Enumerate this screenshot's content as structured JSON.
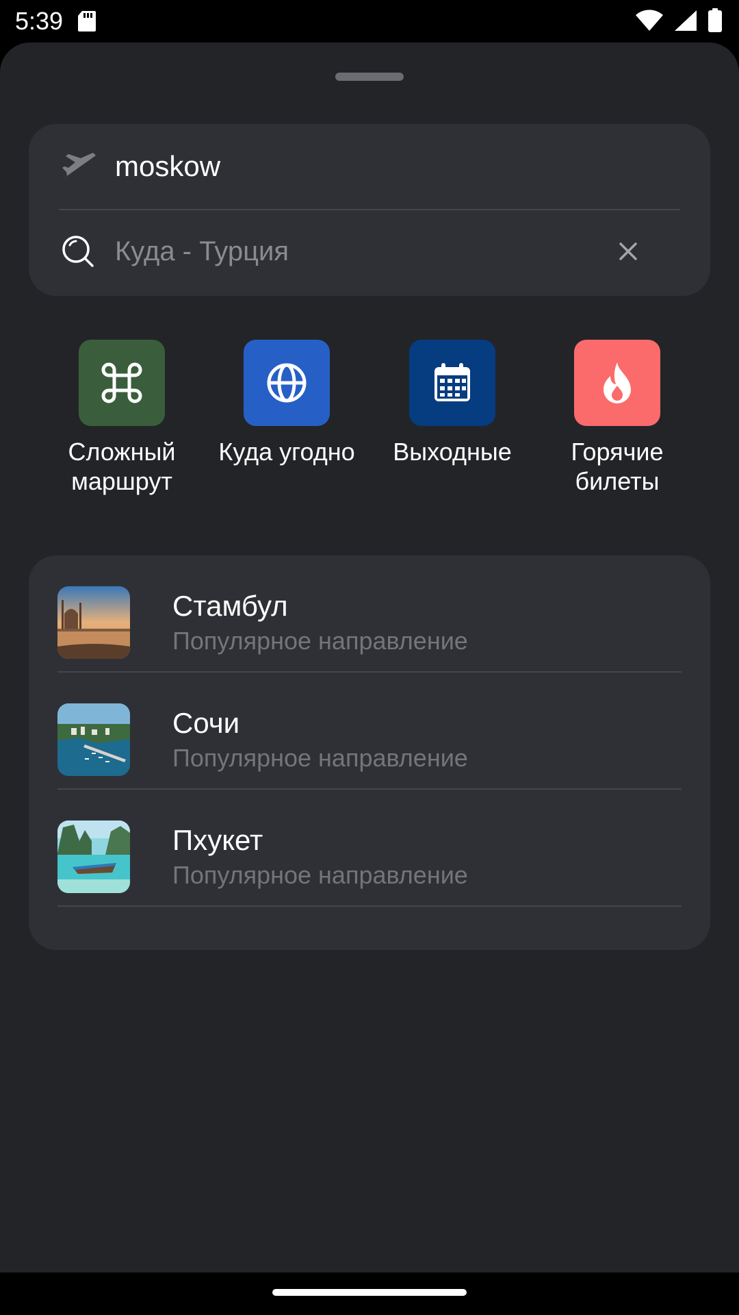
{
  "status_bar": {
    "time": "5:39"
  },
  "search": {
    "from_value": "moskow",
    "to_placeholder": "Куда - Турция"
  },
  "quick_actions": [
    {
      "label": "Сложный\nмаршрут",
      "icon": "command-icon",
      "color": "#3a5e3c"
    },
    {
      "label": "Куда угодно",
      "icon": "globe-icon",
      "color": "#2660c6"
    },
    {
      "label": "Выходные",
      "icon": "calendar-icon",
      "color": "#063c80"
    },
    {
      "label": "Горячие\nбилеты",
      "icon": "fire-icon",
      "color": "#fb6b6b"
    }
  ],
  "destinations": [
    {
      "name": "Стамбул",
      "subtitle": "Популярное направление"
    },
    {
      "name": "Сочи",
      "subtitle": "Популярное направление"
    },
    {
      "name": "Пхукет",
      "subtitle": "Популярное направление"
    }
  ],
  "colors": {
    "sheet_bg": "#232428",
    "card_bg": "#2f3036",
    "muted_text": "#74757b"
  }
}
